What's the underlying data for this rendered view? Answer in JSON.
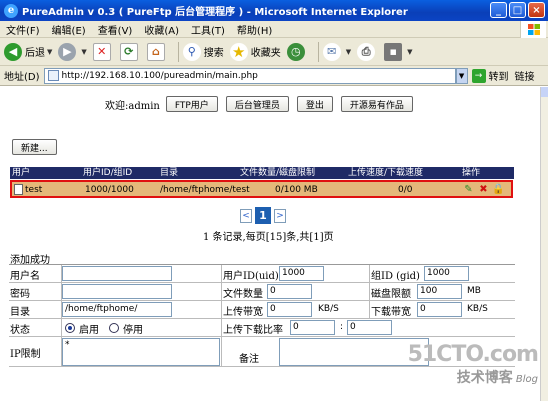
{
  "window": {
    "title": "PureAdmin v 0.3 ( PureFtp 后台管理程序 ) - Microsoft Internet Explorer"
  },
  "menu": [
    "文件(F)",
    "编辑(E)",
    "查看(V)",
    "收藏(A)",
    "工具(T)",
    "帮助(H)"
  ],
  "toolbar": {
    "back": "后退",
    "search": "搜索",
    "favorites": "收藏夹"
  },
  "address": {
    "label": "地址(D)",
    "url": "http://192.168.10.100/pureadmin/main.php",
    "go": "转到",
    "links": "链接"
  },
  "nav": {
    "welcome": "欢迎:admin",
    "buttons": [
      "FTP用户",
      "后台管理员",
      "登出",
      "开源易有作品"
    ]
  },
  "new_button": "新建...",
  "table": {
    "headers": [
      "用户",
      "用户ID/组ID",
      "目录",
      "文件数量/磁盘限制",
      "上传速度/下载速度",
      "操作"
    ],
    "rows": [
      {
        "user": "test",
        "ids": "1000/1000",
        "dir": "/home/ftphome/test",
        "quota": "0/100 MB",
        "speed": "0/0"
      }
    ]
  },
  "pager": {
    "prev": "<",
    "current": "1",
    "next": ">",
    "info": "1 条记录,每页[15]条,共[1]页"
  },
  "form": {
    "title": "添加成功",
    "username_label": "用户名",
    "username": "",
    "uid_label": "用户ID(uid)",
    "uid": "1000",
    "gid_label": "组ID (gid)",
    "gid": "1000",
    "password_label": "密码",
    "password": "",
    "filecount_label": "文件数量",
    "filecount": "0",
    "quota_label": "磁盘限额",
    "quota": "100",
    "quota_unit": "MB",
    "dir_label": "目录",
    "dir": "/home/ftphome/",
    "upbw_label": "上传带宽",
    "upbw": "0",
    "upbw_unit": "KB/S",
    "downbw_label": "下载带宽",
    "downbw": "0",
    "downbw_unit": "KB/S",
    "status_label": "状态",
    "status_on": "启用",
    "status_off": "停用",
    "ratio_label": "上传下载比率",
    "ratio_up": "0",
    "ratio_sep": ":",
    "ratio_down": "0",
    "ip_label": "IP限制",
    "ip_value": "*",
    "note_label": "备注"
  },
  "watermark": {
    "site": "51CTO.com",
    "sub": "技术博客",
    "blog": "Blog"
  }
}
